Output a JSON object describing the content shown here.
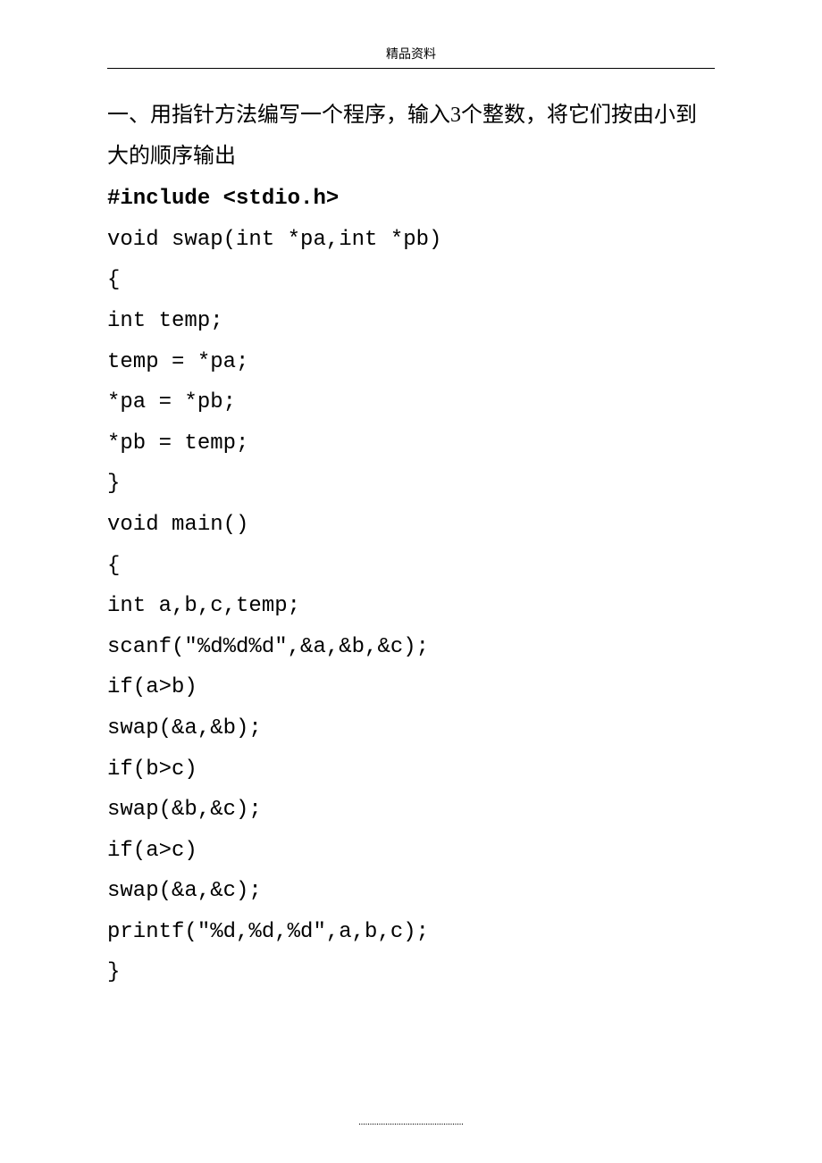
{
  "header": {
    "label": "精品资料"
  },
  "problem": {
    "text": "一、用指针方法编写一个程序，输入3个整数，将它们按由小到大的顺序输出"
  },
  "code": {
    "include": "#include <stdio.h>",
    "lines": [
      "void swap(int *pa,int *pb)",
      "{",
      "int temp;",
      "temp = *pa;",
      "*pa = *pb;",
      "*pb = temp;",
      "}",
      "void main()",
      "{",
      "int a,b,c,temp;",
      "scanf(\"%d%d%d\",&a,&b,&c);",
      "if(a>b)",
      "swap(&a,&b);",
      "if(b>c)",
      "swap(&b,&c);",
      "if(a>c)",
      "swap(&a,&c);",
      "printf(\"%d,%d,%d\",a,b,c);",
      "}"
    ]
  },
  "footer": {
    "dots": "..............................................."
  }
}
